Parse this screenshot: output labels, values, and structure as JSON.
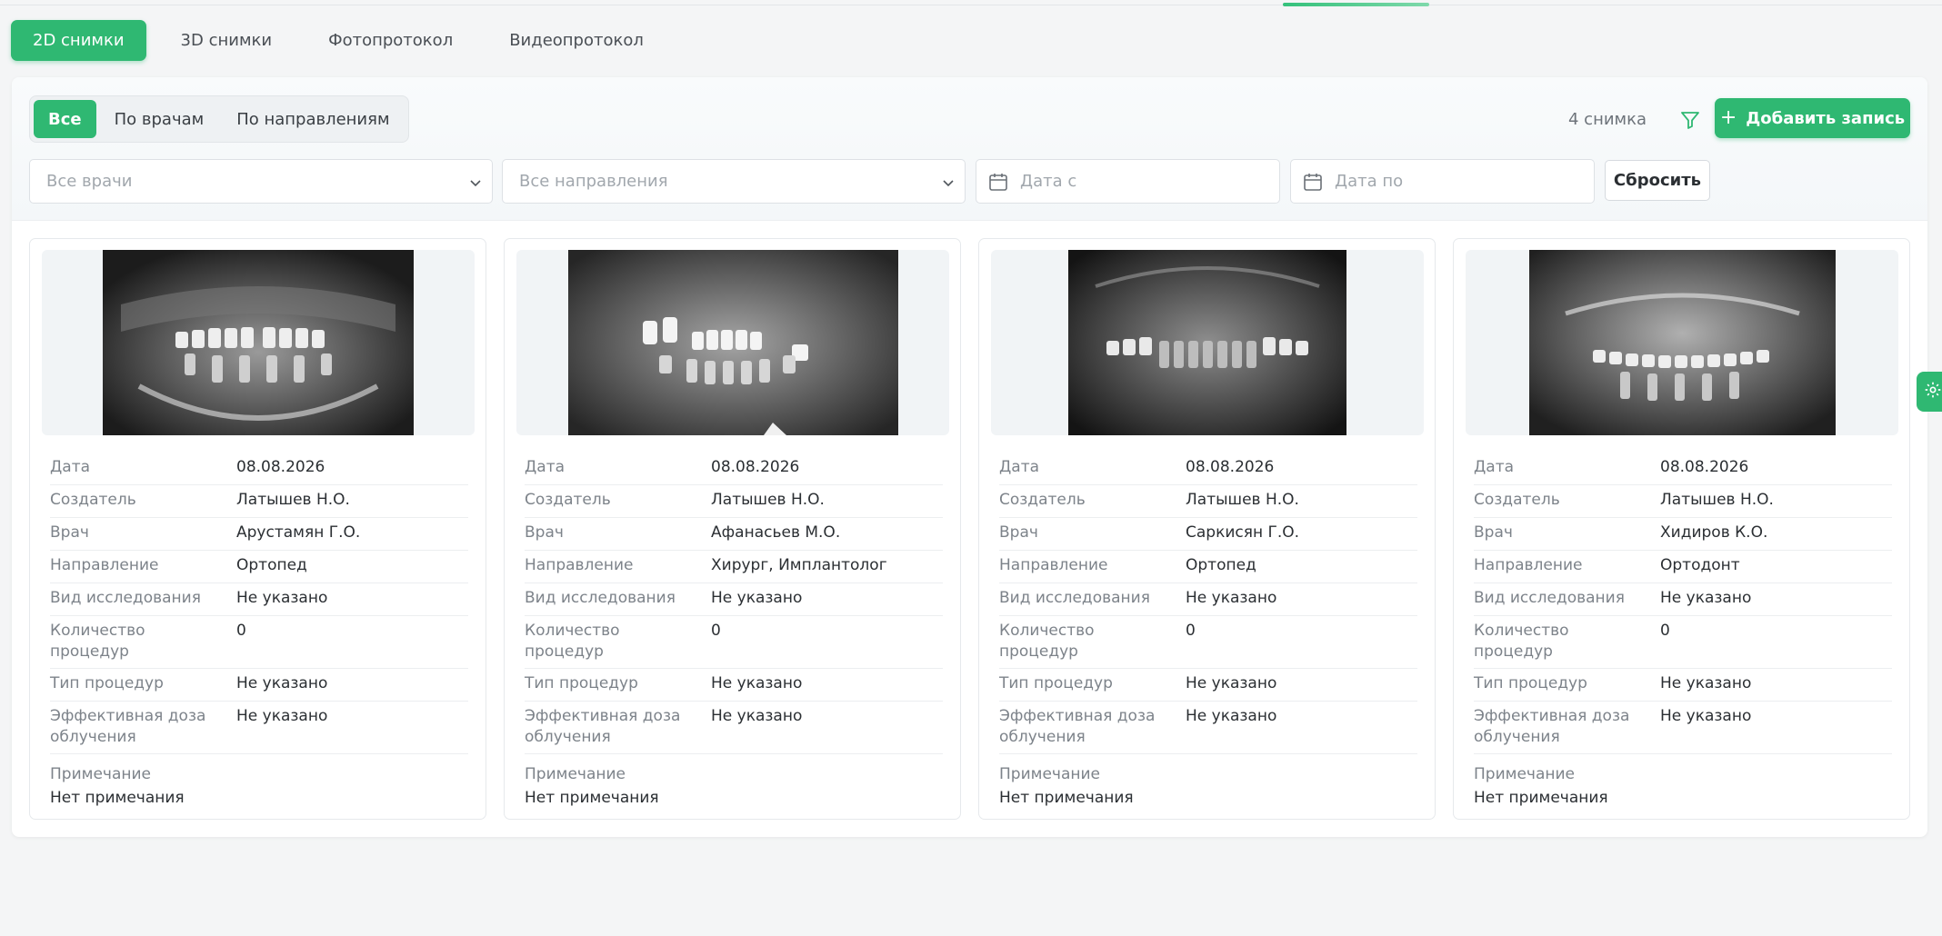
{
  "tabs": [
    "2D снимки",
    "3D снимки",
    "Фотопротокол",
    "Видеопротокол"
  ],
  "segments": [
    "Все",
    "По врачам",
    "По направлениям"
  ],
  "count": "4 снимка",
  "add_button": "Добавить запись",
  "filters": {
    "doctors_placeholder": "Все врачи",
    "directions_placeholder": "Все направления",
    "date_from_placeholder": "Дата с",
    "date_to_placeholder": "Дата по",
    "reset": "Сбросить"
  },
  "labels": {
    "date": "Дата",
    "creator": "Создатель",
    "doctor": "Врач",
    "direction": "Направление",
    "study_type_line": "Вид исследования",
    "proc_count_1": "Количество",
    "proc_count_2": "процедур",
    "proc_type": "Тип процедур",
    "dose_1": "Эффективная доза",
    "dose_2": "облучения",
    "note": "Примечание"
  },
  "cards": [
    {
      "date": "08.08.2026",
      "creator": "Латышев Н.О.",
      "doctor": "Арустамян Г.О.",
      "direction": "Ортопед",
      "study_type": "Не указано",
      "proc_count": "0",
      "proc_type": "Не указано",
      "dose": "Не указано",
      "note": "Нет примечания"
    },
    {
      "date": "08.08.2026",
      "creator": "Латышев Н.О.",
      "doctor": "Афанасьев М.О.",
      "direction": "Хирург, Имплантолог",
      "study_type": "Не указано",
      "proc_count": "0",
      "proc_type": "Не указано",
      "dose": "Не указано",
      "note": "Нет примечания"
    },
    {
      "date": "08.08.2026",
      "creator": "Латышев Н.О.",
      "doctor": "Саркисян Г.О.",
      "direction": "Ортопед",
      "study_type": "Не указано",
      "proc_count": "0",
      "proc_type": "Не указано",
      "dose": "Не указано",
      "note": "Нет примечания"
    },
    {
      "date": "08.08.2026",
      "creator": "Латышев Н.О.",
      "doctor": "Хидиров К.О.",
      "direction": "Ортодонт",
      "study_type": "Не указано",
      "proc_count": "0",
      "proc_type": "Не указано",
      "dose": "Не указано",
      "note": "Нет примечания"
    }
  ],
  "colors": {
    "accent": "#2fb872"
  }
}
